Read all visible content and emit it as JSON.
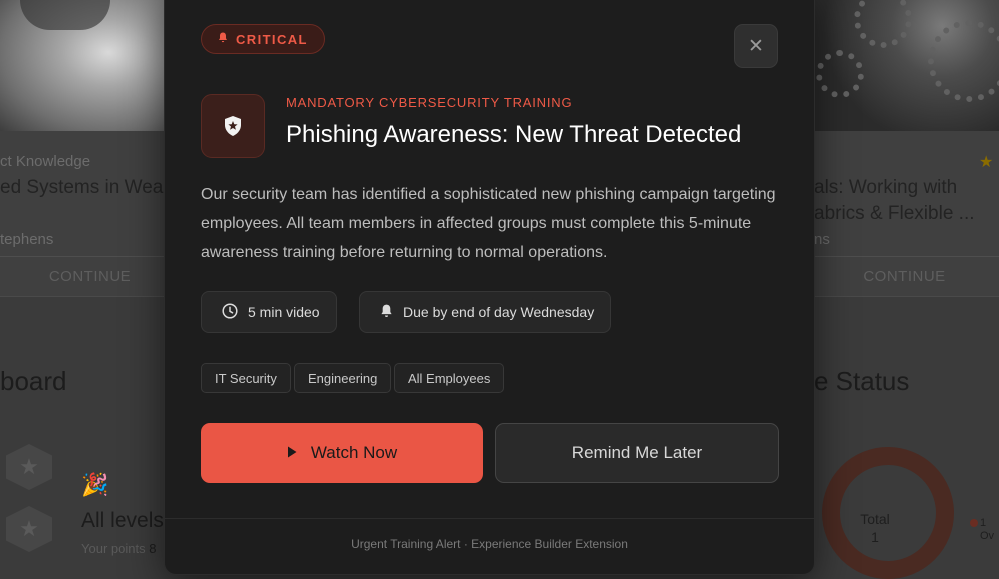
{
  "background": {
    "left_card": {
      "category": "ct Knowledge",
      "title": "ed Systems in Weara",
      "author": "tephens",
      "continue_label": "CONTINUE"
    },
    "right_card": {
      "title_line1": "als: Working with",
      "title_line2": "abrics & Flexible ...",
      "author": "ns",
      "continue_label": "CONTINUE"
    },
    "leaderboard_heading": "board",
    "levels_label": "All levels",
    "points_label": "Your points",
    "points_value": "8",
    "status_heading": "e Status",
    "donut_total_label": "Total",
    "donut_total_value": "1",
    "legend_count": "1",
    "legend_label": "Ov"
  },
  "modal": {
    "severity_label": "CRITICAL",
    "eyebrow": "MANDATORY CYBERSECURITY TRAINING",
    "title": "Phishing Awareness: New Threat Detected",
    "description": "Our security team has identified a sophisticated new phishing campaign targeting employees. All team members in affected groups must complete this 5-minute awareness training before returning to normal operations.",
    "duration": "5 min video",
    "due": "Due by end of day Wednesday",
    "tags": [
      "IT Security",
      "Engineering",
      "All Employees"
    ],
    "primary_button": "Watch Now",
    "secondary_button": "Remind Me Later",
    "footer": "Urgent Training Alert · Experience Builder Extension"
  },
  "colors": {
    "accent": "#ea5645",
    "modal_bg": "#1d1d1d",
    "critical_text": "#ef5a47"
  },
  "icons": [
    "bell-icon",
    "close-icon",
    "shield-star-icon",
    "clock-icon",
    "bell-icon",
    "play-icon",
    "star-icon",
    "party-icon"
  ]
}
